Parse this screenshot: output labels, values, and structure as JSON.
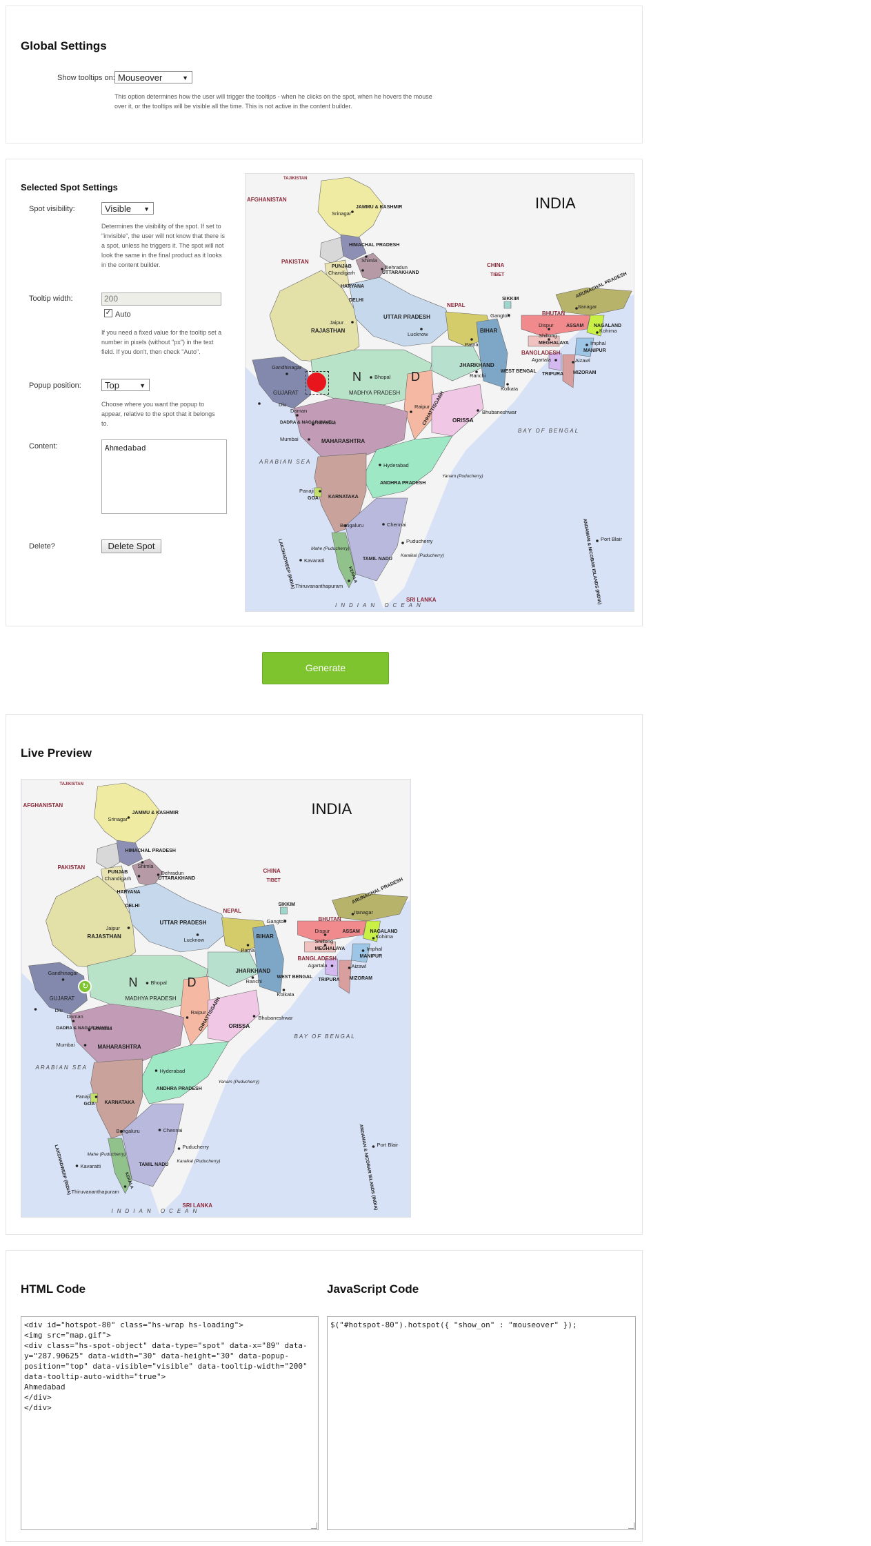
{
  "global": {
    "title": "Global Settings",
    "tooltips_label": "Show tooltips on:",
    "tooltips_value": "Mouseover",
    "tooltips_help": "This option determines how the user will trigger the tooltips - when he clicks on the spot, when he hovers the mouse over it, or the tooltips will be visible all the time. This is not active in the content builder."
  },
  "spot": {
    "title": "Selected Spot Settings",
    "visibility_label": "Spot visibility:",
    "visibility_value": "Visible",
    "visibility_help": "Determines the visibility of the spot. If set to \"invisible\", the user will not know that there is a spot, unless he triggers it. The spot will not look the same in the final product as it looks in the content builder.",
    "tooltip_width_label": "Tooltip width:",
    "tooltip_width_value": "200",
    "auto_label": "Auto",
    "tooltip_width_help": "If you need a fixed value for the tooltip set a number in pixels (without \"px\") in the text field. If you don't, then check \"Auto\".",
    "popup_label": "Popup position:",
    "popup_value": "Top",
    "popup_help": "Choose where you want the popup to appear, relative to the spot that it belongs to.",
    "content_label": "Content:",
    "content_value": "Ahmedabad",
    "delete_label": "Delete?",
    "delete_button": "Delete Spot"
  },
  "generate_button": "Generate",
  "preview": {
    "title": "Live Preview"
  },
  "map": {
    "country": "INDIA",
    "country_initials": [
      "N",
      "D"
    ],
    "colors": {
      "sea": "#d8e2f6",
      "land": "#f2f2f2",
      "spot": "#e8161c",
      "accent": "#7dc42f"
    },
    "neighbors": [
      "AFGHANISTAN",
      "PAKISTAN",
      "CHINA",
      "TIBET",
      "NEPAL",
      "BHUTAN",
      "BANGLADESH",
      "SRI LANKA",
      "TAJIKISTAN"
    ],
    "states": [
      {
        "name": "JAMMU & KASHMIR",
        "color": "#f0eba2"
      },
      {
        "name": "HIMACHAL PRADESH",
        "color": "#8d8fb4"
      },
      {
        "name": "PUNJAB",
        "color": "#d8d8d8"
      },
      {
        "name": "HARYANA",
        "color": "#e8e3b0"
      },
      {
        "name": "UTTARAKHAND",
        "color": "#b69aa6"
      },
      {
        "name": "DELHI",
        "color": "#e9d3c7"
      },
      {
        "name": "RAJASTHAN",
        "color": "#e3e0a8"
      },
      {
        "name": "UTTAR PRADESH",
        "color": "#c6d8ec"
      },
      {
        "name": "BIHAR",
        "color": "#d4cc6a"
      },
      {
        "name": "GUJARAT",
        "color": "#8289ad"
      },
      {
        "name": "MADHYA PRADESH",
        "color": "#b9e3c9"
      },
      {
        "name": "JHARKHAND",
        "color": "#b8e0cf"
      },
      {
        "name": "WEST BENGAL",
        "color": "#7ea6c6"
      },
      {
        "name": "CHHATTISGARH",
        "color": "#f5b8a2"
      },
      {
        "name": "ORISSA",
        "color": "#f0c7e4"
      },
      {
        "name": "MAHARASHTRA",
        "color": "#c29cb6"
      },
      {
        "name": "ANDHRA PRADESH",
        "color": "#9fe8c6"
      },
      {
        "name": "KARNATAKA",
        "color": "#c8a29b"
      },
      {
        "name": "GOA",
        "color": "#c3e06b"
      },
      {
        "name": "KERALA",
        "color": "#92c28c"
      },
      {
        "name": "TAMIL NADU",
        "color": "#b9b9de"
      },
      {
        "name": "SIKKIM",
        "color": "#9ed6ce"
      },
      {
        "name": "ARUNACHAL PRADESH",
        "color": "#b8b36a"
      },
      {
        "name": "ASSAM",
        "color": "#f08a8d"
      },
      {
        "name": "MEGHALAYA",
        "color": "#f1c3c0"
      },
      {
        "name": "NAGALAND",
        "color": "#c9f044"
      },
      {
        "name": "MANIPUR",
        "color": "#9dc5e6"
      },
      {
        "name": "MIZORAM",
        "color": "#d99f9f"
      },
      {
        "name": "TRIPURA",
        "color": "#d4b9f0"
      }
    ],
    "cities": [
      "Srinagar",
      "Shimla",
      "Chandigarh",
      "Dehradun",
      "Jaipur",
      "Lucknow",
      "Patna",
      "Gangtok",
      "Itanagar",
      "Dispur",
      "Shillong",
      "Kohima",
      "Imphal",
      "Aizawl",
      "Agartala",
      "Gandhinagar",
      "Bhopal",
      "Ranchi",
      "Kolkata",
      "Raipur",
      "Bhubaneshwar",
      "Daman",
      "Diu",
      "Silvassa",
      "Mumbai",
      "Hyderabad",
      "Panaji",
      "Bengaluru",
      "Chennai",
      "Puducherry",
      "Kavaratti",
      "Thiruvananthapuram",
      "Port Blair"
    ],
    "water_labels": [
      "ARABIAN SEA",
      "BAY OF BENGAL",
      "INDIAN OCEAN"
    ],
    "territory_labels": [
      "DADRA & NAGAR HAVELI",
      "LAKSHADWEEP (INDIA)",
      "ANDAMAN & NICOBAR ISLANDS (INDIA)",
      "Yanam (Puducherry)",
      "Karaikal (Puducherry)",
      "Mahe (Puducherry)"
    ]
  },
  "code": {
    "html_title": "HTML Code",
    "html_value": "<div id=\"hotspot-80\" class=\"hs-wrap hs-loading\">\n<img src=\"map.gif\">\n<div class=\"hs-spot-object\" data-type=\"spot\" data-x=\"89\" data-y=\"287.90625\" data-width=\"30\" data-height=\"30\" data-popup-position=\"top\" data-visible=\"visible\" data-tooltip-width=\"200\" data-tooltip-auto-width=\"true\">\nAhmedabad\n</div>\n</div>",
    "js_title": "JavaScript Code",
    "js_value": "$(\"#hotspot-80\").hotspot({ \"show_on\" : \"mouseover\" });"
  }
}
